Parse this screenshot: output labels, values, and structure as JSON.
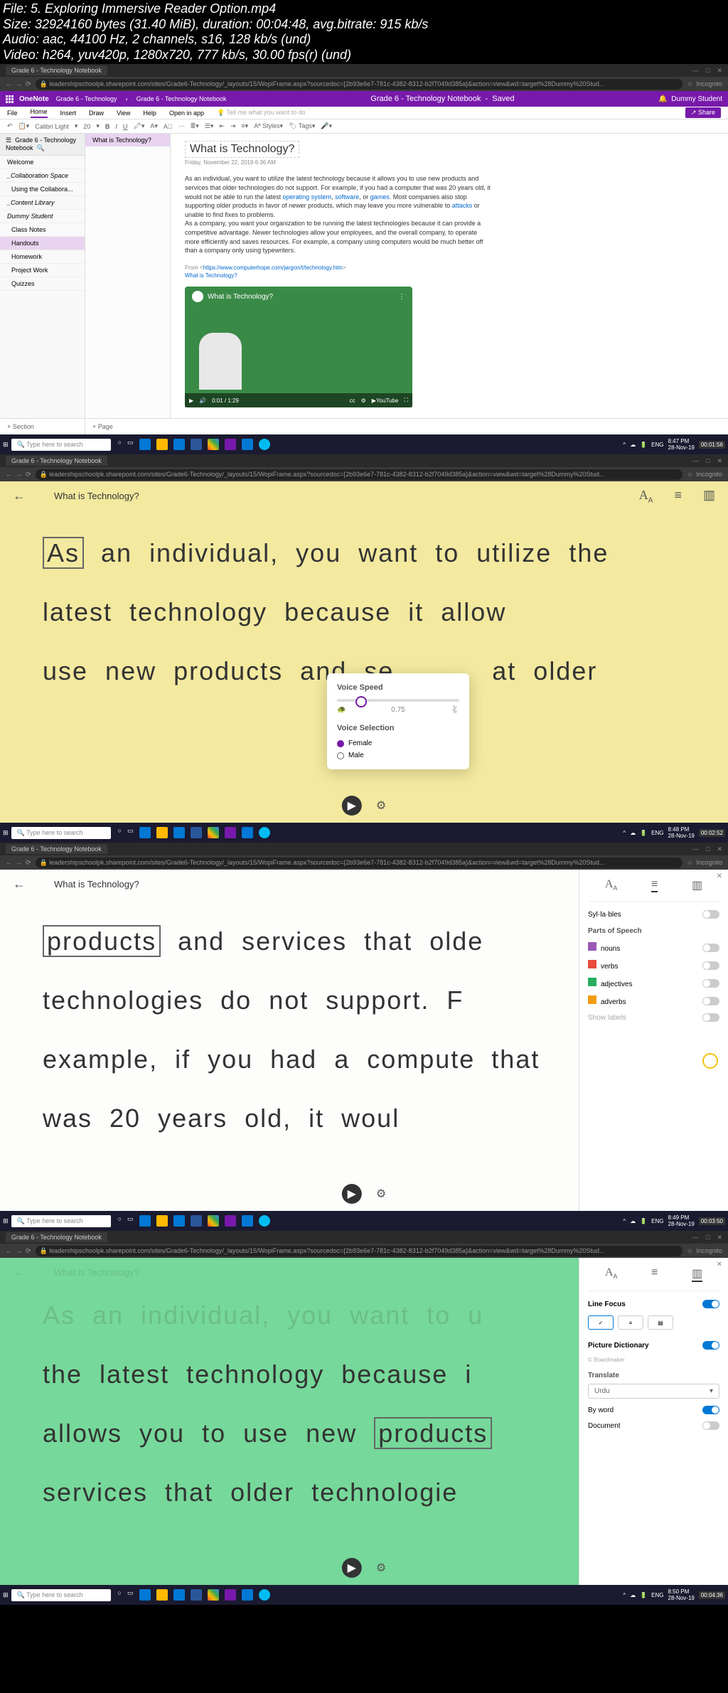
{
  "meta": {
    "file": "File: 5. Exploring Immersive Reader Option.mp4",
    "size": "Size: 32924160 bytes (31.40 MiB), duration: 00:04:48, avg.bitrate: 915 kb/s",
    "audio": "Audio: aac, 44100 Hz, 2 channels, s16, 128 kb/s (und)",
    "video": "Video: h264, yuv420p, 1280x720, 777 kb/s, 30.00 fps(r) (und)"
  },
  "browser": {
    "tab": "Grade 6 - Technology Notebook",
    "url": "leadershipschoolpk.sharepoint.com/sites/Grade6-Technology/_layouts/15/WopiFrame.aspx?sourcedoc={2b93e6e7-781c-4382-8312-b2f7049d385a}&action=view&wd=target%28Dummy%20Stud...",
    "incognito": "Incognito"
  },
  "onenote": {
    "app": "OneNote",
    "crumb1": "Grade 6 - Technology",
    "crumb2": "Grade 6 - Technology Notebook",
    "title": "Grade 6 - Technology Notebook",
    "saved": "Saved",
    "user": "Dummy Student",
    "ribbon": [
      "File",
      "Home",
      "Insert",
      "Draw",
      "View",
      "Help",
      "Open in app",
      "Tell me what you want to do"
    ],
    "toolbar": {
      "font": "Calibri Light",
      "size": "20",
      "styles": "Styles",
      "tags": "Tags",
      "share": "Share"
    },
    "nav_hdr": "Grade 6 - Technology Notebook",
    "nav": [
      "Welcome",
      "_Collaboration Space",
      "Using the Collabora...",
      "_Content Library",
      "Dummy Student",
      "Class Notes",
      "Handouts",
      "Homework",
      "Project Work",
      "Quizzes"
    ],
    "nav_sel": 6,
    "page_sel": "What is Technology?",
    "add_section": "+ Section",
    "add_page": "+ Page",
    "page": {
      "title": "What is Technology?",
      "date": "Friday, November 22, 2019    6:36 AM",
      "p1": "As an individual, you want to utilize the latest technology because it allows you to use new products and services that older technologies do not support. For example, if you had a computer that was 20 years old, it would not be able to run the latest",
      "p1b": ". Most companies also stop supporting older products in favor of newer products, which may leave you more vulnerable to",
      "p1c": " or unable to find fixes to problems.",
      "p2": "As a company, you want your organization to be running the latest technologies because it can provide a competitive advantage. Newer technologies allow your employees, and the overall company, to operate more efficiently and saves resources. For example, a company using computers would be much better off than a company only using typewriters.",
      "link_label1": "operating system",
      "link_label2": "software",
      "link_label3": "games",
      "link_label4": "attacks",
      "from": "From <",
      "from_url": "https://www.computerhope.com/jargon/t/technology.htm",
      "from_end": ">",
      "link_bottom": "What is Technology?",
      "vid_title": "What is Technology?",
      "vid_time": "0:01 / 1:29"
    }
  },
  "taskbar": {
    "search": "Type here to search",
    "time1": "8:47 PM",
    "date1": "28-Nov-19",
    "ts1": "00:01:56",
    "time2": "8:48 PM",
    "date2": "28-Nov-19",
    "ts2": "00:02:52",
    "time3": "8:49 PM",
    "date3": "28-Nov-19",
    "ts3": "00:03:50",
    "time4": "8:50 PM",
    "date4": "28-Nov-19",
    "ts4": "00:04:36",
    "lang": "ENG"
  },
  "ir": {
    "title": "What is Technology?",
    "s2_text_a": "As",
    "s2_text_b": " an individual, you want to utilize the latest technology because it allow",
    "s2_text_c": " use new products and se",
    "s2_text_d": "at older",
    "s3_a": "products",
    "s3_b": " and services that olde",
    "s3_c": "technologies do not support. F",
    "s3_d": "example, if you had a compute",
    "s3_e": "that was 20 years old, it woul",
    "s4_a": "the latest technology because i",
    "s4_b": "allows you to use new ",
    "s4_c": "products",
    "s4_d": "services that older technologie",
    "voice_speed": "Voice Speed",
    "speed_val": "0.75",
    "voice_sel": "Voice Selection",
    "female": "Female",
    "male": "Male",
    "syllables": "Syl·la·bles",
    "pos": "Parts of Speech",
    "nouns": "nouns",
    "verbs": "verbs",
    "adj": "adjectives",
    "adv": "adverbs",
    "show_labels": "Show labels",
    "line_focus": "Line Focus",
    "pic_dict": "Picture Dictionary",
    "pic_sub": "© Boardmaker",
    "translate": "Translate",
    "lang": "Urdu",
    "by_word": "By word",
    "document": "Document"
  }
}
